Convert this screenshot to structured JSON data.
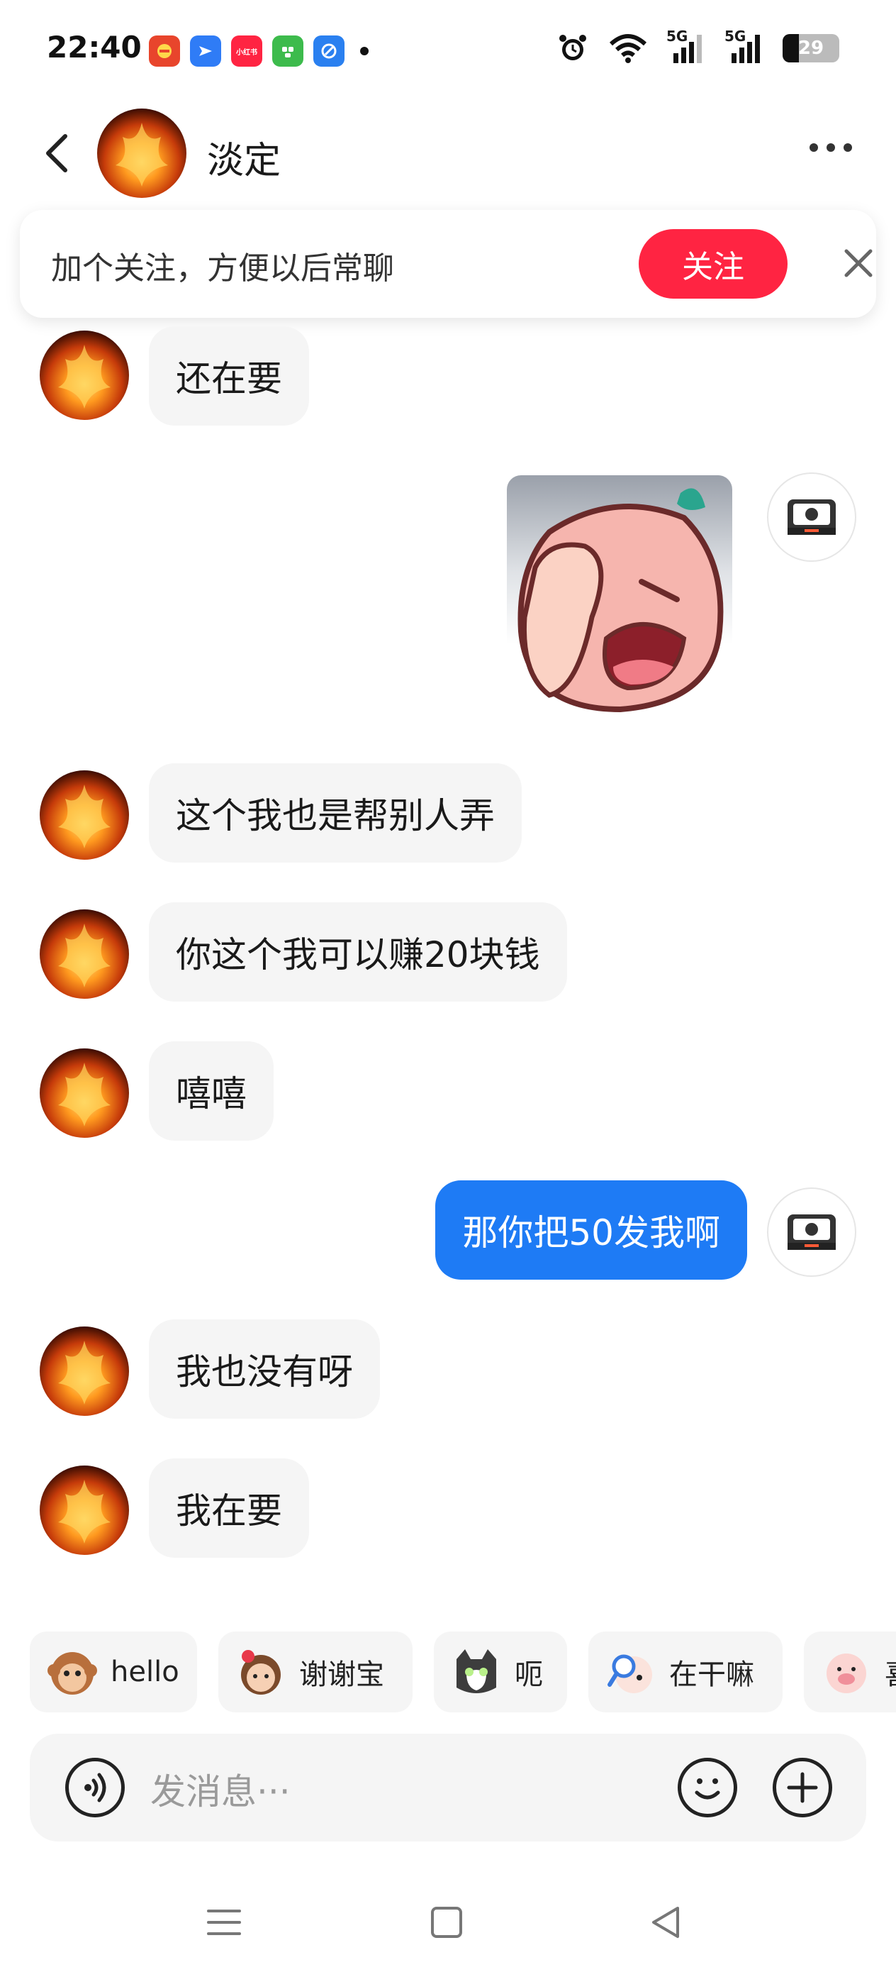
{
  "status_bar": {
    "time": "22:40",
    "network_1": "5G",
    "network_2": "5G",
    "battery": "29",
    "battery_level_percent": 29,
    "app_icons": [
      {
        "name": "waimai-app-icon",
        "color": "#e8452c"
      },
      {
        "name": "feishu-app-icon",
        "color": "#2f7cf6"
      },
      {
        "name": "xiaohongshu-app-icon",
        "color": "#ff2442",
        "text": "小红书"
      },
      {
        "name": "green-app-icon",
        "color": "#3dbb4c"
      },
      {
        "name": "browser-app-icon",
        "color": "#2a80f0"
      }
    ]
  },
  "header": {
    "contact_name": "淡定"
  },
  "follow_banner": {
    "text": "加个关注，方便以后常聊",
    "button_label": "关注"
  },
  "messages": [
    {
      "side": "in",
      "text": "还在要"
    },
    {
      "side": "out",
      "type": "sticker",
      "sticker": "facepalm-yawn-sticker"
    },
    {
      "side": "in",
      "text": "这个我也是帮别人弄"
    },
    {
      "side": "in",
      "text": "你这个我可以赚20块钱"
    },
    {
      "side": "in",
      "text": "嘻嘻"
    },
    {
      "side": "out",
      "text": "那你把50发我啊"
    },
    {
      "side": "in",
      "text": "我也没有呀"
    },
    {
      "side": "in",
      "text": "我在要"
    }
  ],
  "quick_replies": [
    {
      "label": "hello",
      "icon": "monkey-emoji-icon"
    },
    {
      "label": "谢谢宝",
      "icon": "girl-flower-emoji-icon"
    },
    {
      "label": "呃",
      "icon": "cat-emoji-icon"
    },
    {
      "label": "在干嘛",
      "icon": "magnifier-emoji-icon"
    },
    {
      "label": "喜",
      "icon": "pig-emoji-icon"
    }
  ],
  "input": {
    "placeholder": "发消息···"
  },
  "colors": {
    "accent_red": "#ff2442",
    "outgoing_bubble": "#1e7bf5",
    "incoming_bubble": "#f5f5f5"
  }
}
